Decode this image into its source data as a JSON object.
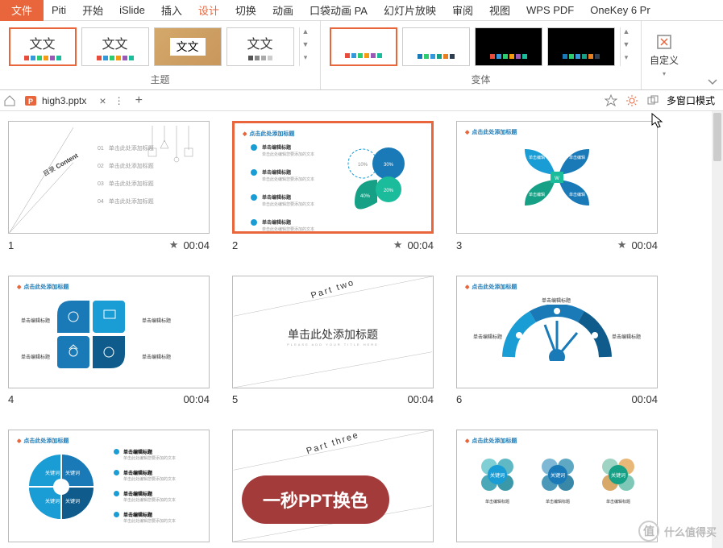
{
  "menu": {
    "file": "文件",
    "piti": "Piti",
    "start": "开始",
    "islide": "iSlide",
    "insert": "插入",
    "design": "设计",
    "transition": "切换",
    "animation": "动画",
    "pocket": "口袋动画 PA",
    "slideshow": "幻灯片放映",
    "review": "审阅",
    "view": "视图",
    "wpspdf": "WPS PDF",
    "onekey": "OneKey 6 Pr"
  },
  "ribbon": {
    "theme_label": "主题",
    "variant_label": "变体",
    "custom": "自定义",
    "theme_text": "文文"
  },
  "doc": {
    "filename": "high3.pptx",
    "multiwindow": "多窗口模式"
  },
  "slides": {
    "placeholder_title": "点击此处添加标题",
    "s1": {
      "label_en": "Content",
      "label_cn": "目录",
      "items": [
        "单击此处添加标题",
        "单击此处添加标题",
        "单击此处添加标题",
        "单击此处添加标题"
      ],
      "nums": [
        "01",
        "02",
        "03",
        "04"
      ]
    },
    "s2": {
      "item_title": "单击编辑标题",
      "item_sub": "单击此处编辑您要添加的文本"
    },
    "s5": {
      "part": "Part two",
      "title": "单击此处添加标题",
      "sub": "PLEASE ADD YOUR TITLE HERE"
    },
    "s8": {
      "part": "Part three"
    },
    "meta": {
      "n1": "1",
      "n2": "2",
      "n3": "3",
      "n4": "4",
      "n5": "5",
      "n6": "6",
      "time": "00:04"
    }
  },
  "banner": "一秒PPT换色",
  "watermark": "什么值得买"
}
